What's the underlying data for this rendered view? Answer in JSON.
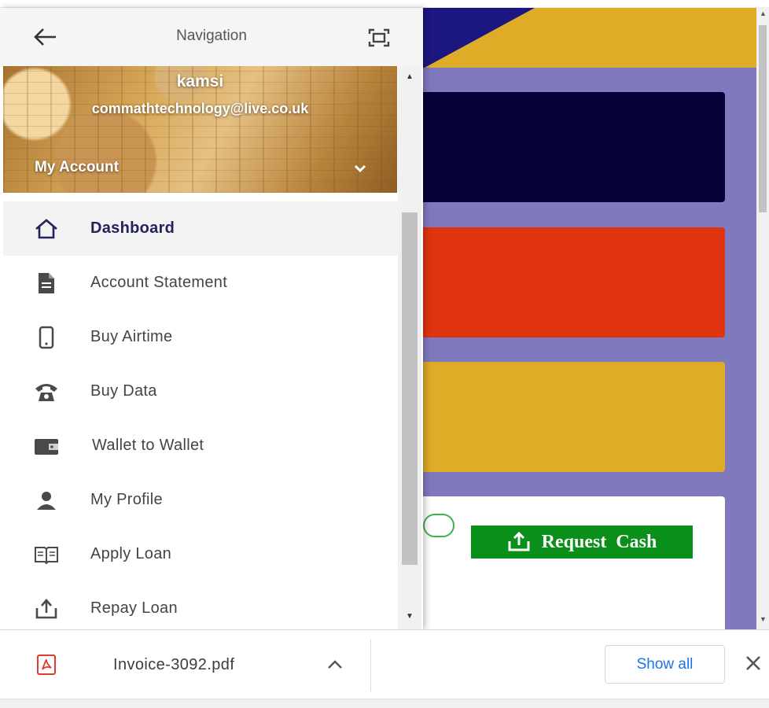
{
  "background": {
    "request_cash_label": "Request  Cash",
    "colors": {
      "page_bg": "#8079bd",
      "banner": "#dfac27",
      "card_dark": "#050238",
      "card_red": "#e03411",
      "card_yellow": "#dfac27",
      "button_green": "#0a8f1a"
    }
  },
  "drawer": {
    "title": "Navigation",
    "header_icons": [
      "arrow-left-icon",
      "expand-icon"
    ],
    "user": {
      "name": "kamsi",
      "email": "commathtechnology@live.co.uk",
      "account_label": "My Account"
    },
    "items": [
      {
        "label": "Dashboard",
        "icon": "home-icon",
        "active": true
      },
      {
        "label": "Account Statement",
        "icon": "document-icon",
        "active": false
      },
      {
        "label": "Buy Airtime",
        "icon": "phone-icon",
        "active": false
      },
      {
        "label": "Buy Data",
        "icon": "telephone-icon",
        "active": false
      },
      {
        "label": "Wallet to Wallet",
        "icon": "wallet-icon",
        "active": false
      },
      {
        "label": "My Profile",
        "icon": "person-icon",
        "active": false
      },
      {
        "label": "Apply Loan",
        "icon": "book-icon",
        "active": false
      },
      {
        "label": "Repay Loan",
        "icon": "upload-icon",
        "active": false
      }
    ],
    "active_color": "#23235c"
  },
  "download_bar": {
    "filename": "Invoice-3092.pdf",
    "file_icon": "pdf-icon",
    "show_all_label": "Show all",
    "link_color": "#1a73e8"
  }
}
